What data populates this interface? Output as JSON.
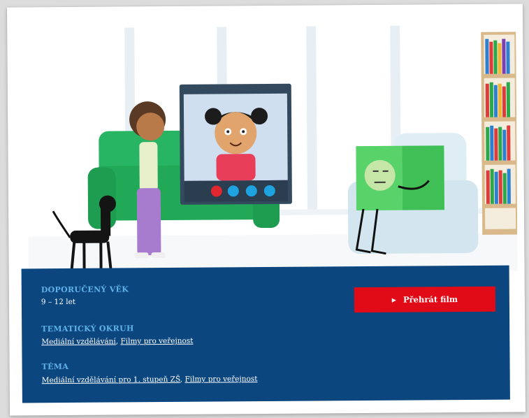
{
  "colors": {
    "panel": "#0b467f",
    "label": "#5fb2e8",
    "play_button": "#e10b17",
    "sofa": "#22b35e",
    "chair": "#d9e9f0"
  },
  "details": {
    "age": {
      "label": "DOPORUČENÝ VĚK",
      "value": "9 – 12 let"
    },
    "topic_area": {
      "label": "TEMATICKÝ OKRUH",
      "links": [
        "Mediální vzdělávání",
        "Filmy pro veřejnost"
      ],
      "separator": ", "
    },
    "theme": {
      "label": "TÉMA",
      "links": [
        "Mediální vzdělávání pro 1. stupeň ZŠ",
        "Filmy pro veřejnost"
      ],
      "separator": ", "
    }
  },
  "play": {
    "icon": "play-icon",
    "label": "Přehrát film"
  },
  "call_buttons": [
    "hang-up-icon",
    "camera-icon",
    "microphone-icon",
    "more-icon"
  ]
}
